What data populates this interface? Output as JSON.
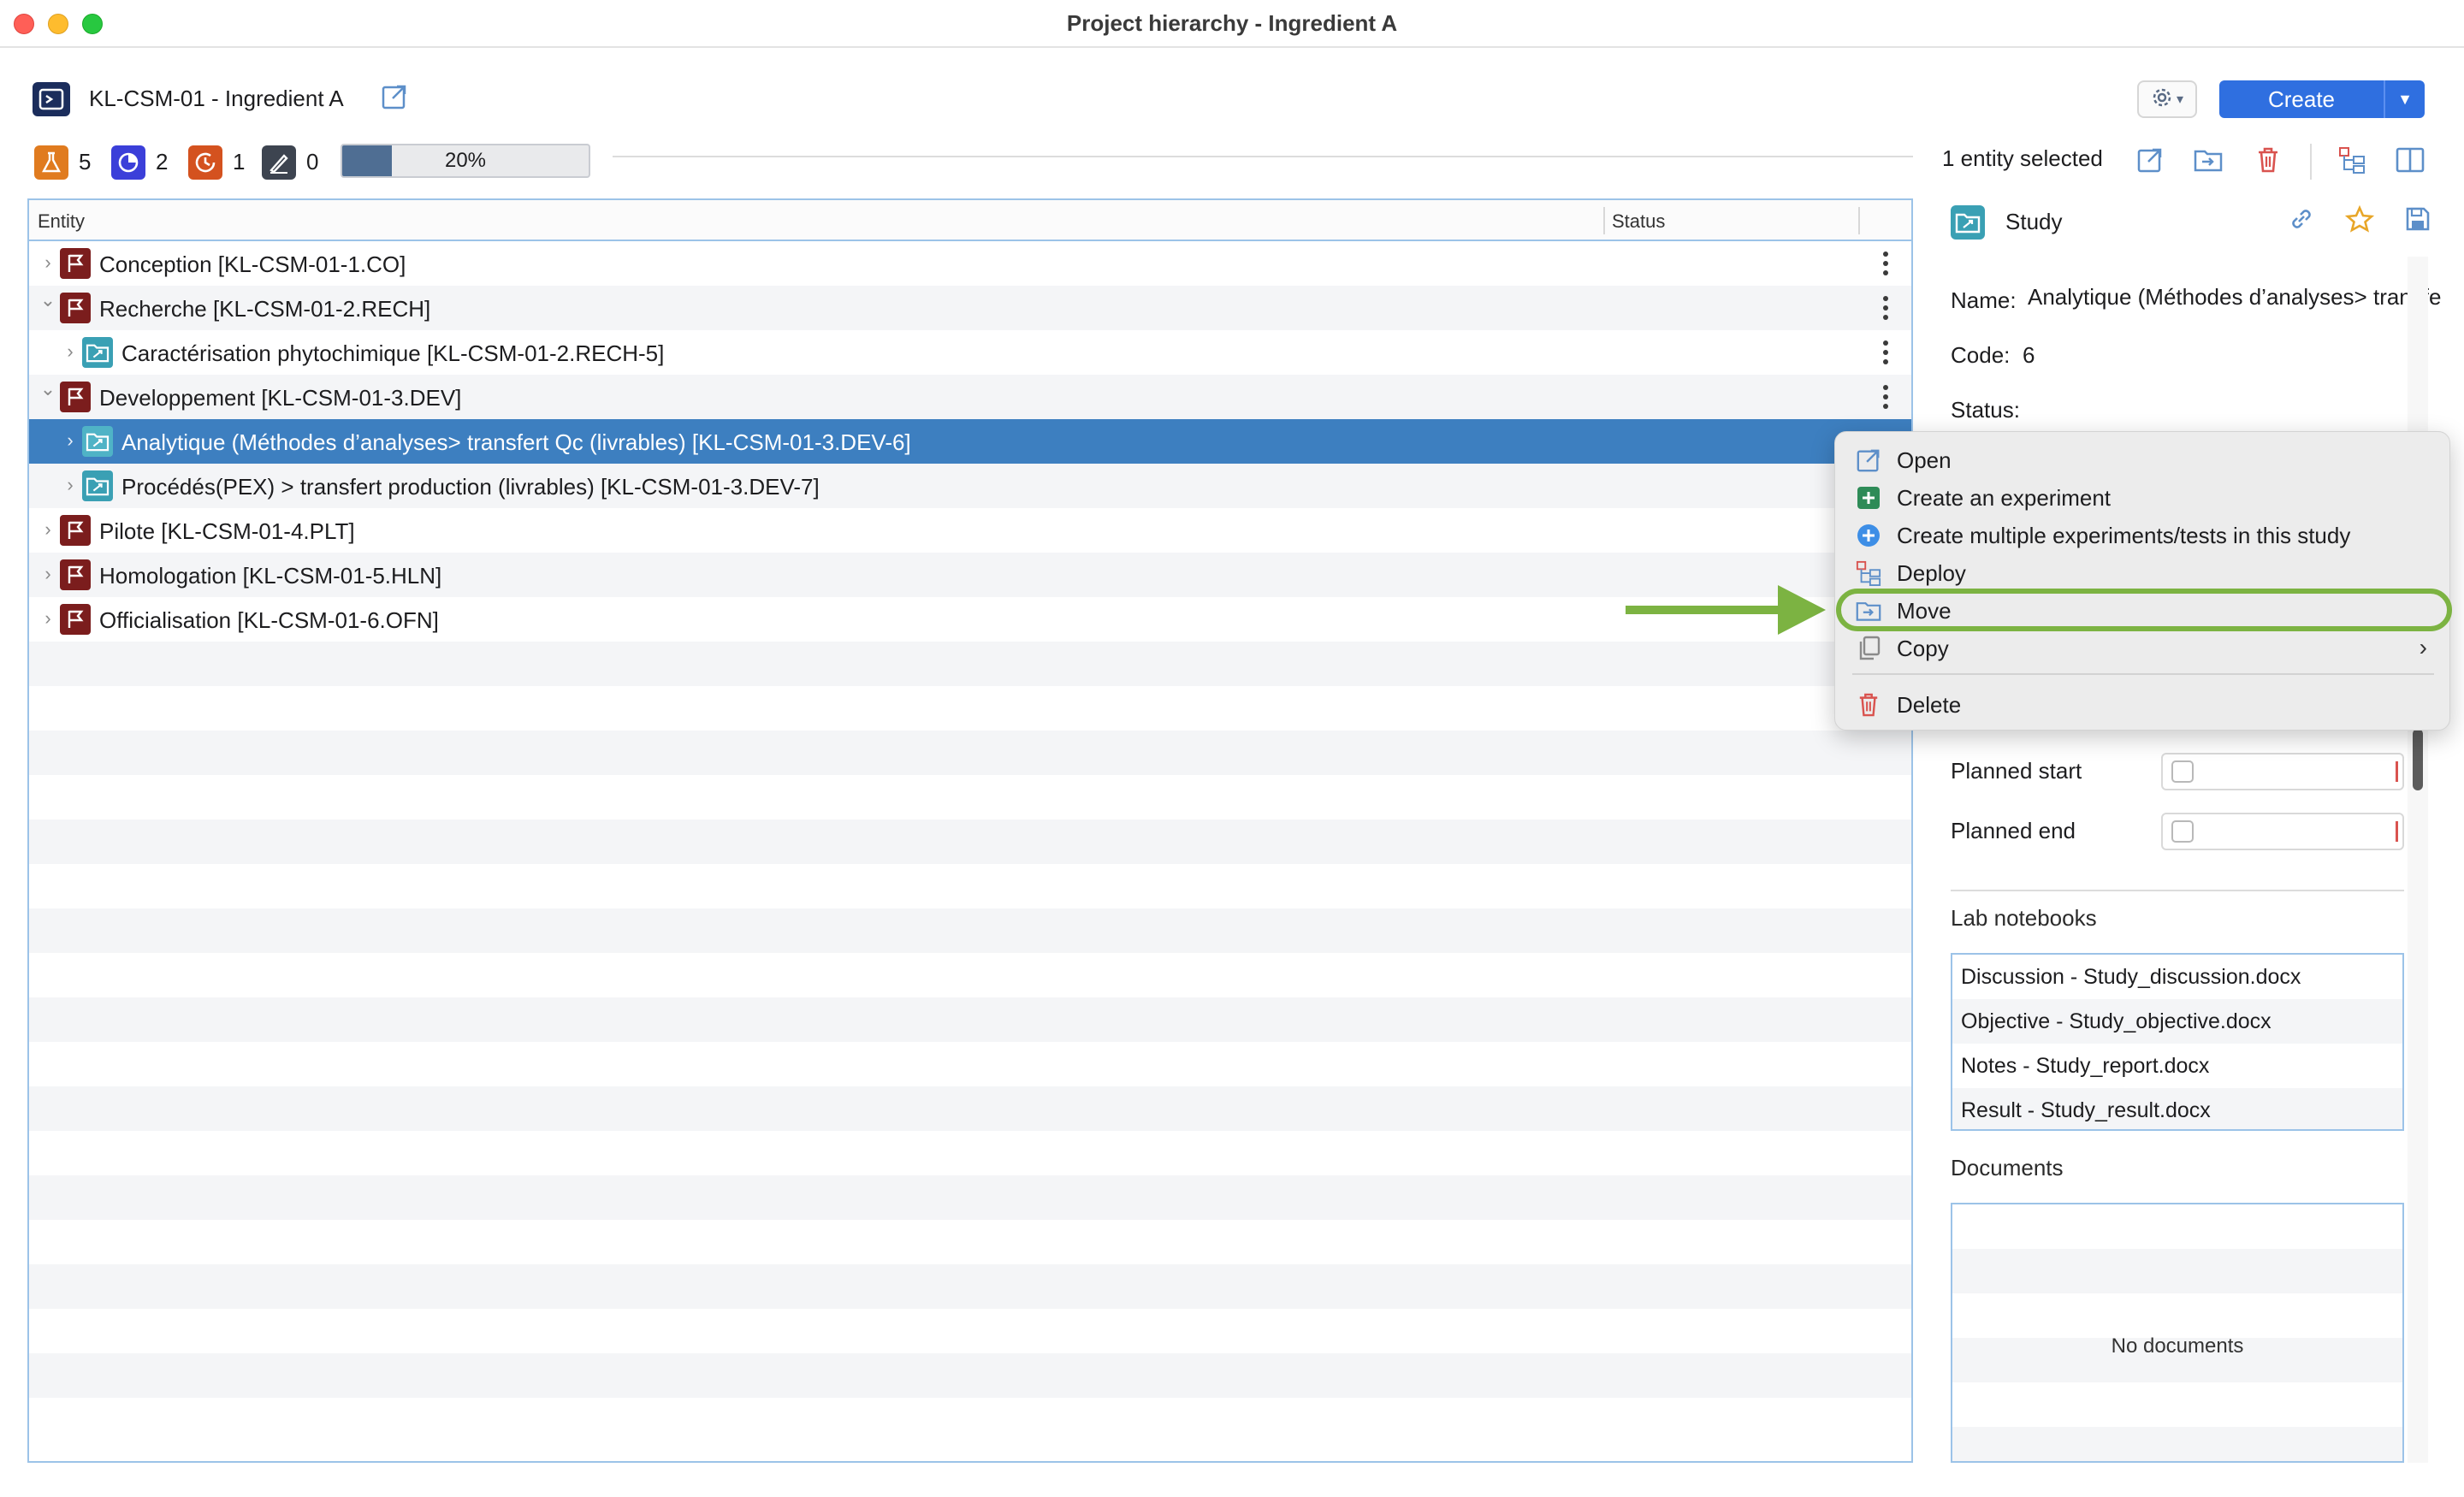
{
  "window": {
    "title": "Project hierarchy - Ingredient A"
  },
  "header": {
    "project_title": "KL-CSM-01 - Ingredient A",
    "create_label": "Create"
  },
  "counts": {
    "experiments": "5",
    "studies_pending": "2",
    "in_progress": "1",
    "signed": "0"
  },
  "progress": {
    "value": 0.2,
    "label": "20%"
  },
  "selection": {
    "text": "1 entity selected"
  },
  "table": {
    "columns": [
      "Entity",
      "Status"
    ],
    "rows": [
      {
        "label": "Conception [KL-CSM-01-1.CO]",
        "kind": "flag",
        "level": 0,
        "expanded": false,
        "selected": false,
        "has_menu": true
      },
      {
        "label": "Recherche [KL-CSM-01-2.RECH]",
        "kind": "flag",
        "level": 0,
        "expanded": true,
        "selected": false,
        "has_menu": true
      },
      {
        "label": "Caractérisation phytochimique [KL-CSM-01-2.RECH-5]",
        "kind": "study",
        "level": 1,
        "expanded": false,
        "selected": false,
        "has_menu": true
      },
      {
        "label": "Developpement [KL-CSM-01-3.DEV]",
        "kind": "flag",
        "level": 0,
        "expanded": true,
        "selected": false,
        "has_menu": true
      },
      {
        "label": "Analytique (Méthodes d’analyses> transfert Qc (livrables) [KL-CSM-01-3.DEV-6]",
        "kind": "study",
        "level": 1,
        "expanded": false,
        "selected": true,
        "has_menu": false
      },
      {
        "label": "Procédés(PEX) > transfert production (livrables) [KL-CSM-01-3.DEV-7]",
        "kind": "study",
        "level": 1,
        "expanded": false,
        "selected": false,
        "has_menu": false
      },
      {
        "label": "Pilote [KL-CSM-01-4.PLT]",
        "kind": "flag",
        "level": 0,
        "expanded": false,
        "selected": false,
        "has_menu": false
      },
      {
        "label": "Homologation [KL-CSM-01-5.HLN]",
        "kind": "flag",
        "level": 0,
        "expanded": false,
        "selected": false,
        "has_menu": false
      },
      {
        "label": "Officialisation [KL-CSM-01-6.OFN]",
        "kind": "flag",
        "level": 0,
        "expanded": false,
        "selected": false,
        "has_menu": false
      }
    ]
  },
  "details": {
    "type": "Study",
    "name_label": "Name:",
    "name_value": "Analytique (Méthodes d’analyses> transfe",
    "code_label": "Code:",
    "code_value": "6",
    "status_label": "Status:",
    "planned_start_label": "Planned start",
    "planned_end_label": "Planned end",
    "lab_notebooks_title": "Lab notebooks",
    "lab_notebooks": [
      "Discussion - Study_discussion.docx",
      "Objective - Study_objective.docx",
      "Notes - Study_report.docx",
      "Result - Study_result.docx"
    ],
    "documents_title": "Documents",
    "no_documents": "No documents"
  },
  "context_menu": {
    "items": [
      {
        "label": "Open",
        "icon": "open-external-icon"
      },
      {
        "label": "Create an experiment",
        "icon": "plus-square-icon"
      },
      {
        "label": "Create multiple experiments/tests in this study",
        "icon": "plus-circle-icon"
      },
      {
        "label": "Deploy",
        "icon": "hierarchy-icon"
      },
      {
        "label": "Move",
        "icon": "move-folder-icon"
      },
      {
        "label": "Copy",
        "icon": "copy-icon",
        "submenu": true
      },
      {
        "label": "Delete",
        "icon": "trash-icon"
      }
    ]
  },
  "annotation": {
    "highlighted_item": "Move",
    "color": "#7cb342"
  },
  "colors": {
    "accent": "#2f6fe0",
    "selection": "#3d7fc0",
    "flag": "#7b1d1d",
    "study": "#3aa0b4",
    "delete": "#d9534f"
  }
}
